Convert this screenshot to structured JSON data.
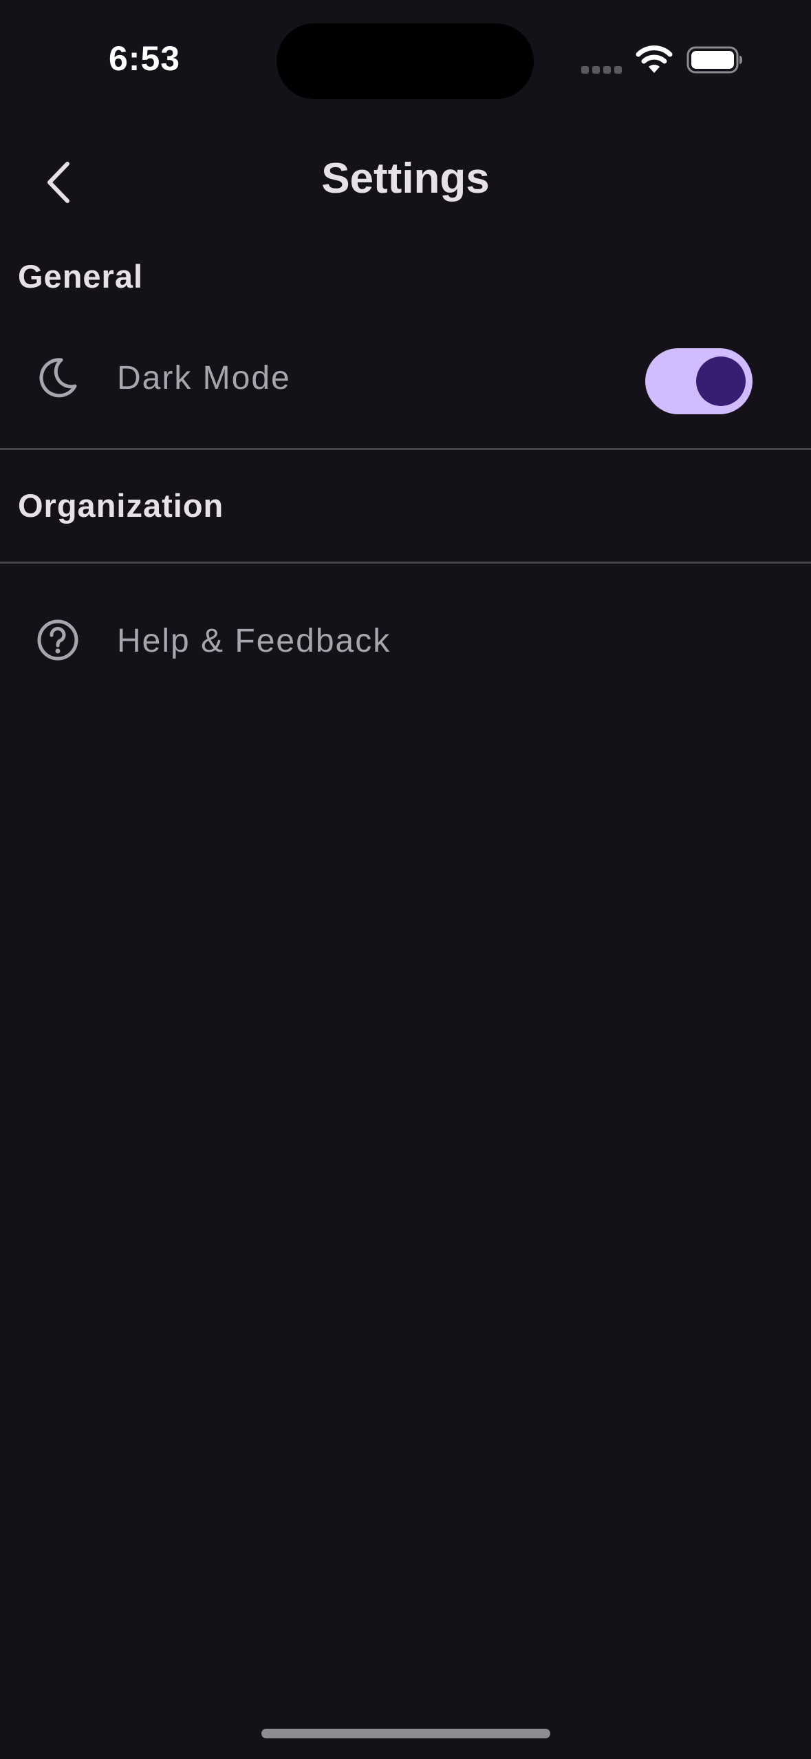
{
  "status_bar": {
    "time": "6:53",
    "icons": [
      "signal-icon",
      "wifi-icon",
      "battery-icon"
    ]
  },
  "app_bar": {
    "back_icon": "chevron-left-icon",
    "title": "Settings"
  },
  "sections": {
    "general": {
      "title": "General",
      "dark_mode": {
        "icon": "moon-icon",
        "label": "Dark Mode",
        "enabled": true
      }
    },
    "organization": {
      "title": "Organization"
    },
    "help": {
      "icon": "help-circle-icon",
      "label": "Help & Feedback"
    }
  },
  "colors": {
    "background": "#141218",
    "toggle_track": "#D0BCFF",
    "toggle_thumb": "#381E72",
    "label_muted": "#A9A5AE",
    "divider": "#46434B"
  }
}
